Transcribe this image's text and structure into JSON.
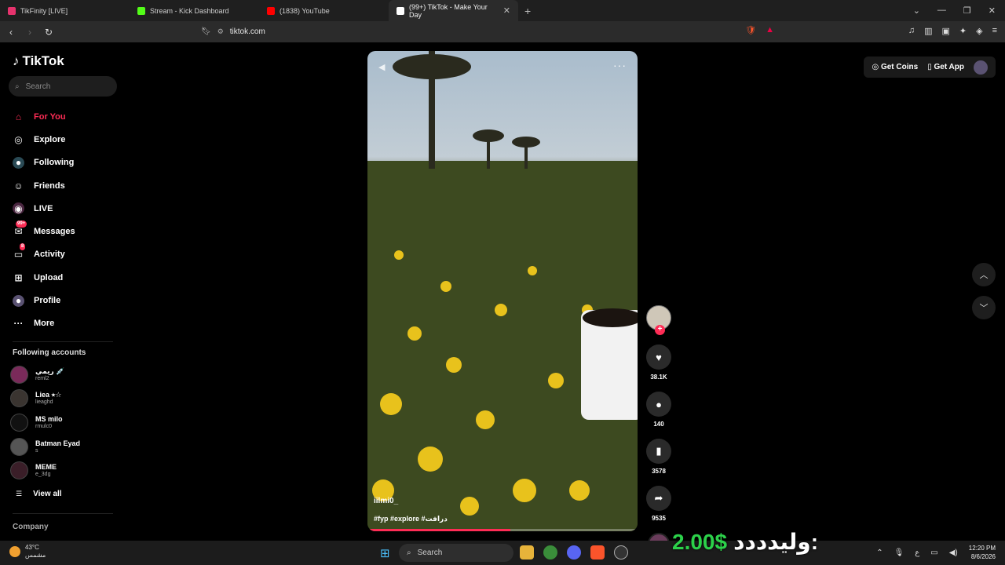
{
  "browser": {
    "tabs": [
      {
        "title": "TikFinity [LIVE]",
        "color": "#e6336d",
        "active": false
      },
      {
        "title": "Stream - Kick Dashboard",
        "color": "#53fc18",
        "active": false
      },
      {
        "title": "(1838) YouTube",
        "color": "#ff0000",
        "active": false
      },
      {
        "title": "(99+) TikTok - Make Your Day",
        "color": "#ffffff",
        "active": true
      }
    ],
    "new_tab": "+",
    "url": "tiktok.com"
  },
  "sidebar": {
    "logo": "TikTok",
    "search_placeholder": "Search",
    "nav": [
      {
        "label": "For You",
        "icon": "home-icon",
        "active": true
      },
      {
        "label": "Explore",
        "icon": "compass-icon"
      },
      {
        "label": "Following",
        "icon": "following-icon"
      },
      {
        "label": "Friends",
        "icon": "friends-icon"
      },
      {
        "label": "LIVE",
        "icon": "live-icon"
      },
      {
        "label": "Messages",
        "icon": "messages-icon",
        "badge": "99+"
      },
      {
        "label": "Activity",
        "icon": "activity-icon",
        "badge": "8"
      },
      {
        "label": "Upload",
        "icon": "upload-icon"
      },
      {
        "label": "Profile",
        "icon": "profile-icon"
      },
      {
        "label": "More",
        "icon": "more-icon"
      }
    ],
    "following_title": "Following accounts",
    "accounts": [
      {
        "name": "ريمي 💉",
        "handle": "reml2"
      },
      {
        "name": "Liea ⭑☆",
        "handle": "lieaghd"
      },
      {
        "name": "MS milo",
        "handle": "rmulc0"
      },
      {
        "name": "Batman Eyad",
        "handle": "s"
      },
      {
        "name": "MEME",
        "handle": "e_3dg"
      }
    ],
    "view_all": "View all",
    "company": "Company"
  },
  "video": {
    "author": "iilmi0_",
    "caption": "#fyp #explore #درافت",
    "progress": 0.53
  },
  "actions": {
    "likes": "38.1K",
    "comments": "140",
    "saves": "3578",
    "shares": "9535"
  },
  "topbar": {
    "get_coins": "Get Coins",
    "get_app": "Get App"
  },
  "taskbar": {
    "temp": "43°C",
    "weather": "مشمس",
    "search": "Search",
    "time": "12:20 PM",
    "date": "8/6/2026",
    "lang": "ع"
  },
  "overlay": {
    "price": "2.00$",
    "label": "وليدددد:"
  }
}
